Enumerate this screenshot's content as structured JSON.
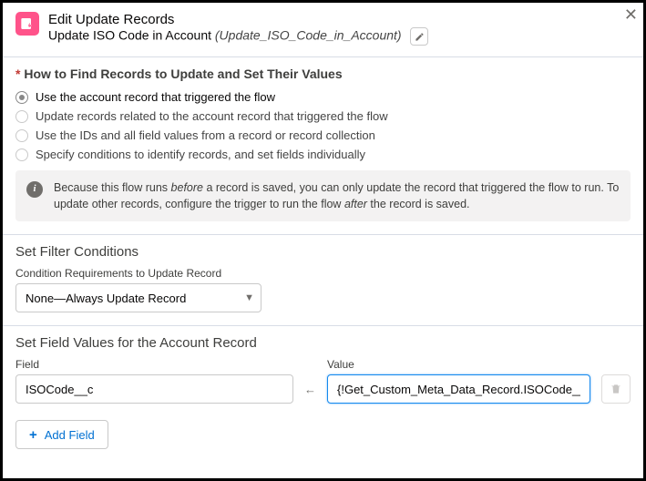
{
  "header": {
    "title": "Edit Update Records",
    "subtitle": "Update ISO Code in Account",
    "api_name": "(Update_ISO_Code_in_Account)"
  },
  "find_records": {
    "title": "How to Find Records to Update and Set Their Values",
    "options": [
      "Use the account record that triggered the flow",
      "Update records related to the account record that triggered the flow",
      "Use the IDs and all field values from a record or record collection",
      "Specify conditions to identify records, and set fields individually"
    ],
    "info_prefix": "Because this flow runs ",
    "info_em1": "before",
    "info_mid": " a record is saved, you can only update the record that triggered the flow to run. To update other records, configure the trigger to run the flow ",
    "info_em2": "after",
    "info_suffix": " the record is saved."
  },
  "filter": {
    "title": "Set Filter Conditions",
    "label": "Condition Requirements to Update Record",
    "value": "None—Always Update Record"
  },
  "field_values": {
    "title": "Set Field Values for the Account Record",
    "field_label": "Field",
    "value_label": "Value",
    "field_value": "ISOCode__c",
    "value_value": "{!Get_Custom_Meta_Data_Record.ISOCode__c}",
    "add_label": "Add Field"
  }
}
